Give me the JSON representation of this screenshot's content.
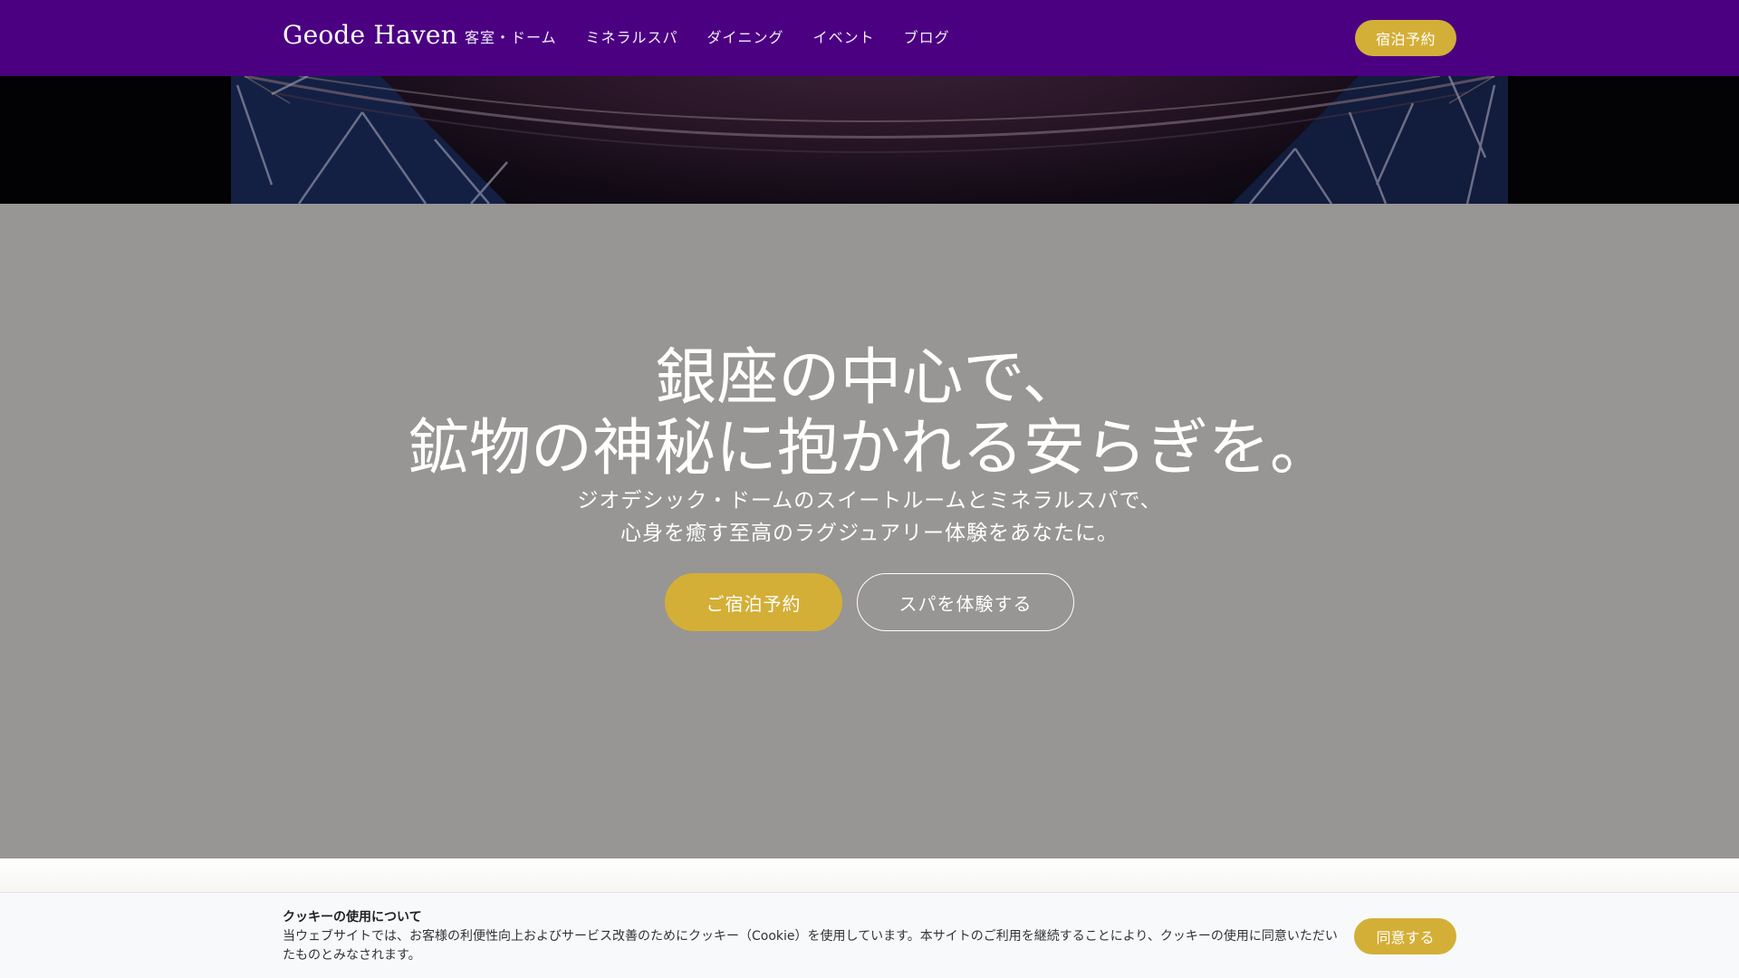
{
  "header": {
    "brand": "Geode Haven",
    "nav": [
      {
        "label": "客室・ドーム"
      },
      {
        "label": "ミネラルスパ"
      },
      {
        "label": "ダイニング"
      },
      {
        "label": "イベント"
      },
      {
        "label": "ブログ"
      }
    ],
    "book_button": "宿泊予約"
  },
  "hero": {
    "title_line1": "銀座の中心で、",
    "title_line2": "鉱物の神秘に抱かれる安らぎを。",
    "subtitle_line1": "ジオデシック・ドームのスイートルームとミネラルスパで、",
    "subtitle_line2": "心身を癒す至高のラグジュアリー体験をあなたに。",
    "primary_button": "ご宿泊予約",
    "secondary_button": "スパを体験する"
  },
  "cookie": {
    "title": "クッキーの使用について",
    "text": "当ウェブサイトでは、お客様の利便性向上およびサービス改善のためにクッキー（Cookie）を使用しています。本サイトのご利用を継続することにより、クッキーの使用に同意いただいたものとみなされます。",
    "accept_button": "同意する"
  },
  "colors": {
    "header_bg": "#4b0082",
    "accent_gold": "#d4af37",
    "hero_overlay": "#979694"
  }
}
